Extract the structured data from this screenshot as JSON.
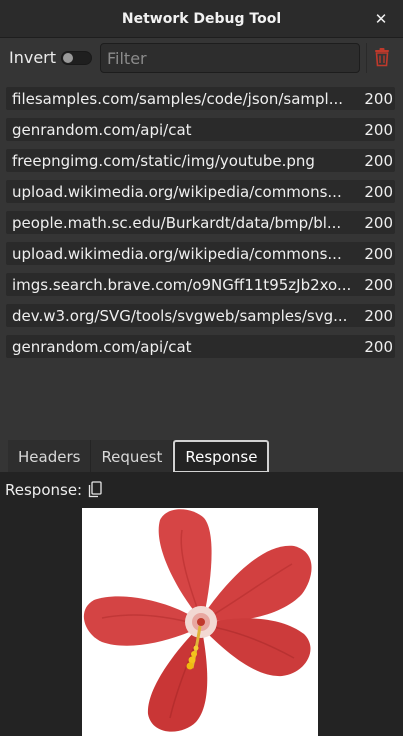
{
  "window": {
    "title": "Network Debug Tool",
    "close_icon": "close-icon"
  },
  "toolbar": {
    "invert_label": "Invert",
    "invert_on": false,
    "filter_value": "",
    "filter_placeholder": "Filter",
    "clear_icon": "trash-icon"
  },
  "requests": [
    {
      "url": "filesamples.com/samples/code/json/sampl...",
      "status": "200"
    },
    {
      "url": "genrandom.com/api/cat",
      "status": "200"
    },
    {
      "url": "freepngimg.com/static/img/youtube.png",
      "status": "200"
    },
    {
      "url": "upload.wikimedia.org/wikipedia/commons...",
      "status": "200"
    },
    {
      "url": "people.math.sc.edu/Burkardt/data/bmp/bl...",
      "status": "200"
    },
    {
      "url": "upload.wikimedia.org/wikipedia/commons...",
      "status": "200"
    },
    {
      "url": "imgs.search.brave.com/o9NGff11t95zJb2xo...",
      "status": "200"
    },
    {
      "url": "dev.w3.org/SVG/tools/svgweb/samples/svg...",
      "status": "200"
    },
    {
      "url": "genrandom.com/api/cat",
      "status": "200"
    }
  ],
  "tabs": [
    {
      "label": "Headers",
      "active": false
    },
    {
      "label": "Request",
      "active": false
    },
    {
      "label": "Response",
      "active": true
    }
  ],
  "response": {
    "label": "Response:",
    "copy_icon": "copy-icon",
    "preview_icon": "hibiscus-flower-image"
  },
  "colors": {
    "window_bg": "#353535",
    "titlebar_bg": "#2b2b2b",
    "row_bg": "#2a2a2a",
    "panel_bg": "#232323",
    "danger": "#c0392b"
  }
}
